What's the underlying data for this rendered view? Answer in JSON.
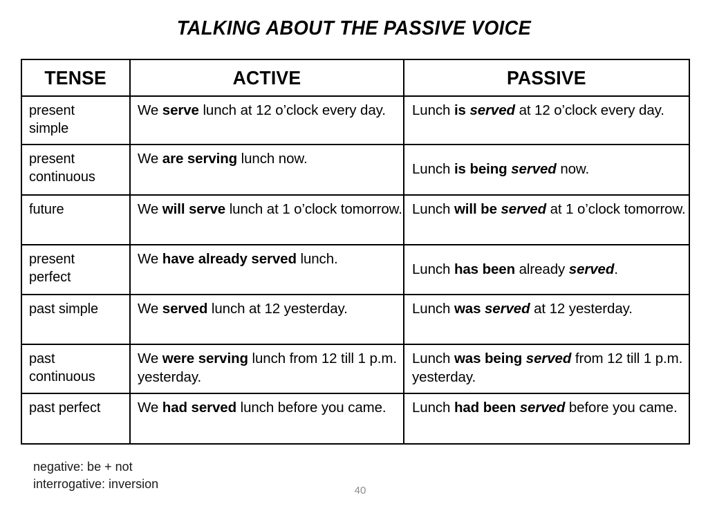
{
  "slide": {
    "title": "TALKING ABOUT THE PASSIVE VOICE",
    "page_number": "40",
    "background_color": "#ffffff",
    "text_color": "#000000",
    "page_number_color": "#8c8c8c"
  },
  "table": {
    "headers": {
      "tense": "TENSE",
      "active": "ACTIVE",
      "passive": "PASSIVE"
    },
    "rows": [
      {
        "tense": "present\nsimple",
        "active_plain_1": "We ",
        "active_bold": "serve",
        "active_plain_2": " lunch at 12 o’clock every day.",
        "passive_plain_1": "Lunch ",
        "passive_bold": "is ",
        "passive_bold_italic": "served",
        "passive_plain_2": " at 12 o’clock every day.",
        "active_align": "top",
        "passive_align": "top"
      },
      {
        "tense": "present\ncontinuous",
        "active_plain_1": "We ",
        "active_bold": "are serving",
        "active_plain_2": " lunch now.",
        "passive_plain_1": "Lunch ",
        "passive_bold": "is being ",
        "passive_bold_italic": "served",
        "passive_plain_2": " now.",
        "active_align": "top",
        "passive_align": "middle"
      },
      {
        "tense": "future",
        "active_plain_1": "We ",
        "active_bold": "will serve",
        "active_plain_2": " lunch at 1 o’clock tomorrow.",
        "passive_plain_1": "Lunch ",
        "passive_bold": "will be ",
        "passive_bold_italic": "served",
        "passive_plain_2": " at 1 o’clock tomorrow.",
        "active_align": "top",
        "passive_align": "top"
      },
      {
        "tense": "present\nperfect",
        "active_plain_1": "We ",
        "active_bold": "have already served",
        "active_plain_2": " lunch.",
        "passive_plain_1": "Lunch ",
        "passive_bold": "has been ",
        "passive_plain_mid": "already ",
        "passive_bold_italic": "served",
        "passive_plain_2": ".",
        "active_align": "top",
        "passive_align": "middle"
      },
      {
        "tense": "past simple",
        "active_plain_1": "We ",
        "active_bold": "served",
        "active_plain_2": " lunch at 12 yesterday.",
        "passive_plain_1": "Lunch ",
        "passive_bold": "was ",
        "passive_bold_italic": "served",
        "passive_plain_2": " at 12 yesterday.",
        "active_align": "top",
        "passive_align": "top"
      },
      {
        "tense": "past\ncontinuous",
        "active_plain_1": "We ",
        "active_bold": "were serving",
        "active_plain_2": " lunch from 12 till 1 p.m. yesterday.",
        "passive_plain_1": "Lunch ",
        "passive_bold": "was being ",
        "passive_bold_italic": "served",
        "passive_plain_2": " from 12 till 1 p.m. yesterday.",
        "active_align": "top",
        "passive_align": "top"
      },
      {
        "tense": "past perfect",
        "active_plain_1": "We ",
        "active_bold": "had served",
        "active_plain_2": " lunch before you came.",
        "passive_plain_1": "Lunch ",
        "passive_bold": "had been ",
        "passive_bold_italic": "served",
        "passive_plain_2": " before you came.",
        "active_align": "top",
        "passive_align": "top"
      }
    ]
  },
  "notes": {
    "line1": "negative: be + not",
    "line2": "interrogative: inversion"
  }
}
